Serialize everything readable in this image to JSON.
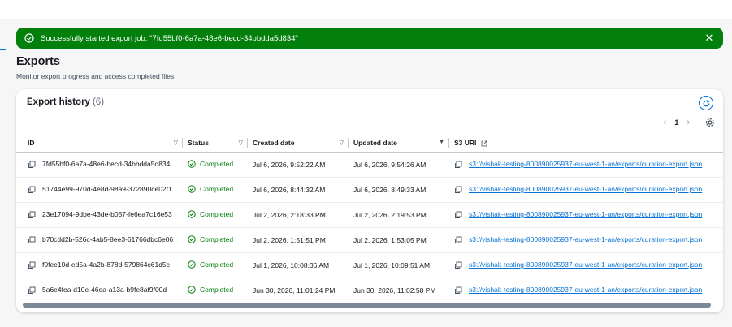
{
  "flash": {
    "message": "Successfully started export job: \"7fd55bf0-6a7a-48e6-becd-34bbdda5d834\"",
    "close_label": "✕",
    "color": "#037f0c"
  },
  "page": {
    "title": "Exports",
    "description": "Monitor export progress and access completed files."
  },
  "history": {
    "title": "Export history",
    "count": "(6)",
    "pagination": {
      "prev": "‹",
      "current": "1",
      "next": "›"
    },
    "columns": {
      "id": "ID",
      "status": "Status",
      "created": "Created date",
      "updated": "Updated date",
      "s3": "S3 URI"
    },
    "rows": [
      {
        "id": "7fd55bf0-6a7a-48e6-becd-34bbdda5d834",
        "status": "Completed",
        "created": "Jul 6, 2026, 9:52:22 AM",
        "updated": "Jul 6, 2026, 9:54:26 AM",
        "s3": "s3://vishak-testing-800890025937-eu-west-1-an/exports/curation-export.json"
      },
      {
        "id": "51744e99-970d-4e8d-98a9-372890ce02f1",
        "status": "Completed",
        "created": "Jul 6, 2026, 8:44:32 AM",
        "updated": "Jul 6, 2026, 8:49:33 AM",
        "s3": "s3://vishak-testing-800890025937-eu-west-1-an/exports/curation-export.json"
      },
      {
        "id": "23e17094-9dbe-43de-b057-fe6ea7c16e53",
        "status": "Completed",
        "created": "Jul 2, 2026, 2:18:33 PM",
        "updated": "Jul 2, 2026, 2:19:53 PM",
        "s3": "s3://vishak-testing-800890025937-eu-west-1-an/exports/curation-export.json"
      },
      {
        "id": "b70cdd2b-526c-4ab5-8ee3-61766dbc6e06",
        "status": "Completed",
        "created": "Jul 2, 2026, 1:51:51 PM",
        "updated": "Jul 2, 2026, 1:53:05 PM",
        "s3": "s3://vishak-testing-800890025937-eu-west-1-an/exports/curation-export.json"
      },
      {
        "id": "f0fee10d-ed5a-4a2b-878d-579864c61d5c",
        "status": "Completed",
        "created": "Jul 1, 2026, 10:08:36 AM",
        "updated": "Jul 1, 2026, 10:09:51 AM",
        "s3": "s3://vishak-testing-800890025937-eu-west-1-an/exports/curation-export.json"
      },
      {
        "id": "5a6e4fea-d10e-46ea-a13a-b9fe8af9f00d",
        "status": "Completed",
        "created": "Jun 30, 2026, 11:01:24 PM",
        "updated": "Jun 30, 2026, 11:02:58 PM",
        "s3": "s3://vishak-testing-800890025937-eu-west-1-an/exports/curation-export.json"
      }
    ]
  },
  "colors": {
    "link": "#0972d3",
    "success": "#037f0c"
  }
}
